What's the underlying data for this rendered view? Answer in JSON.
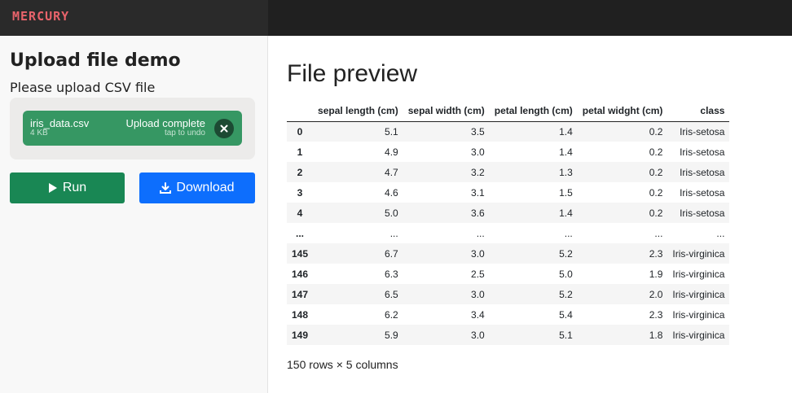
{
  "app": {
    "logo": "MERCURY"
  },
  "sidebar": {
    "title": "Upload file demo",
    "upload_label": "Please upload CSV file",
    "upload": {
      "file_name": "iris_data.csv",
      "file_size": "4 KB",
      "status": "Upload complete",
      "status_hint": "tap to undo"
    },
    "run_label": "Run",
    "download_label": "Download"
  },
  "main": {
    "title": "File preview",
    "table": {
      "columns": [
        "",
        "sepal length (cm)",
        "sepal width (cm)",
        "petal length (cm)",
        "petal widght (cm)",
        "class"
      ],
      "rows": [
        [
          "0",
          "5.1",
          "3.5",
          "1.4",
          "0.2",
          "Iris-setosa"
        ],
        [
          "1",
          "4.9",
          "3.0",
          "1.4",
          "0.2",
          "Iris-setosa"
        ],
        [
          "2",
          "4.7",
          "3.2",
          "1.3",
          "0.2",
          "Iris-setosa"
        ],
        [
          "3",
          "4.6",
          "3.1",
          "1.5",
          "0.2",
          "Iris-setosa"
        ],
        [
          "4",
          "5.0",
          "3.6",
          "1.4",
          "0.2",
          "Iris-setosa"
        ],
        [
          "...",
          "...",
          "...",
          "...",
          "...",
          "..."
        ],
        [
          "145",
          "6.7",
          "3.0",
          "5.2",
          "2.3",
          "Iris-virginica"
        ],
        [
          "146",
          "6.3",
          "2.5",
          "5.0",
          "1.9",
          "Iris-virginica"
        ],
        [
          "147",
          "6.5",
          "3.0",
          "5.2",
          "2.0",
          "Iris-virginica"
        ],
        [
          "148",
          "6.2",
          "3.4",
          "5.4",
          "2.3",
          "Iris-virginica"
        ],
        [
          "149",
          "5.9",
          "3.0",
          "5.1",
          "1.8",
          "Iris-virginica"
        ]
      ]
    },
    "shape_text": "150 rows × 5 columns"
  }
}
